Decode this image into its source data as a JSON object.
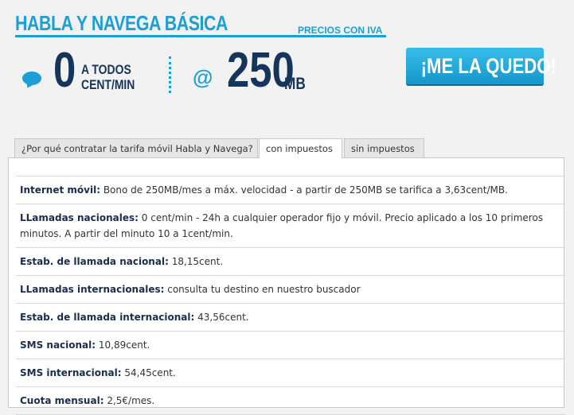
{
  "header": {
    "title": "HABLA Y NAVEGA BÁSICA",
    "price_note": "PRECIOS CON IVA"
  },
  "plan": {
    "calls_value": "0",
    "calls_label_1": "A TODOS",
    "calls_label_2": "CENT/MIN",
    "at_symbol": "@",
    "data_value": "250",
    "data_unit": "MB"
  },
  "cta": {
    "label": "¡ME LA QUEDO!"
  },
  "tabs": [
    {
      "label": "¿Por qué contratar la tarifa móvil Habla y Navega?"
    },
    {
      "label": "con impuestos"
    },
    {
      "label": "sin impuestos"
    }
  ],
  "rows": [
    {
      "label": "Internet móvil:",
      "value": "Bono de 250MB/mes a máx. velocidad - a partir de 250MB se tarifica a 3,63cent/MB."
    },
    {
      "label": "LLamadas nacionales:",
      "value": "0 cent/min - 24h a cualquier operador fijo y móvil. Precio aplicado a los 10 primeros minutos. A partir del minuto 10 a 1cent/min."
    },
    {
      "label": "Estab. de llamada nacional:",
      "value": "18,15cent."
    },
    {
      "label": "LLamadas internacionales:",
      "value": "consulta tu destino en nuestro buscador"
    },
    {
      "label": "Estab. de llamada internacional:",
      "value": "43,56cent."
    },
    {
      "label": "SMS nacional:",
      "value": "10,89cent."
    },
    {
      "label": "SMS internacional:",
      "value": "54,45cent."
    },
    {
      "label": "Cuota mensual:",
      "value": "2,5€/mes."
    }
  ],
  "colors": {
    "accent": "#1aa0d6",
    "navy": "#15355a"
  }
}
